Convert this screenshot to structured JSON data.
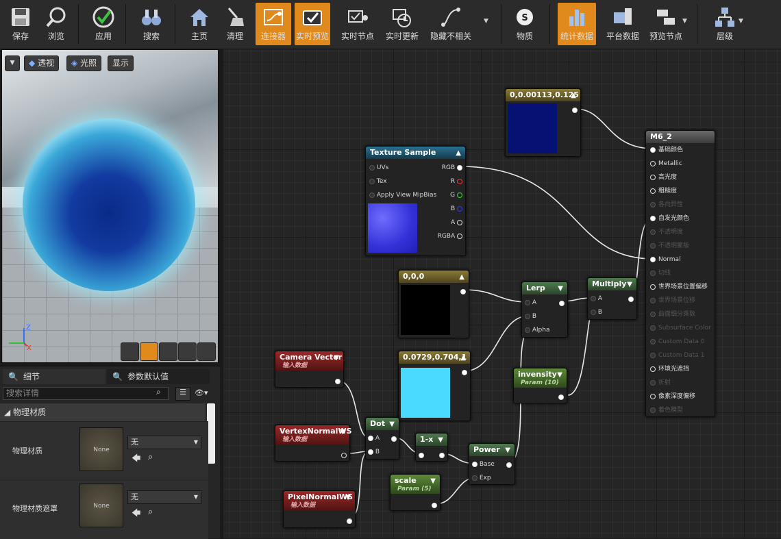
{
  "toolbar": {
    "buttons": [
      {
        "key": "save",
        "label": "保存",
        "icon": "save-icon",
        "active": false
      },
      {
        "key": "browse",
        "label": "浏览",
        "icon": "browse-icon",
        "active": false
      },
      {
        "key": "apply",
        "label": "应用",
        "icon": "apply-icon",
        "active": false
      },
      {
        "key": "search",
        "label": "搜索",
        "icon": "binoculars-icon",
        "active": false
      },
      {
        "key": "home",
        "label": "主页",
        "icon": "home-icon",
        "active": false
      },
      {
        "key": "clean",
        "label": "清理",
        "icon": "broom-icon",
        "active": false
      },
      {
        "key": "connectors",
        "label": "连接器",
        "icon": "connector-icon",
        "active": true
      },
      {
        "key": "live_preview",
        "label": "实时预览",
        "icon": "live-preview-icon",
        "active": true
      },
      {
        "key": "live_nodes",
        "label": "实时节点",
        "icon": "live-nodes-icon",
        "active": false
      },
      {
        "key": "live_update",
        "label": "实时更新",
        "icon": "live-update-icon",
        "active": false
      },
      {
        "key": "hide_unrelated",
        "label": "隐藏不相关",
        "icon": "hide-unrelated-icon",
        "active": false
      },
      {
        "key": "substance",
        "label": "物质",
        "icon": "substance-icon",
        "active": false
      },
      {
        "key": "stats",
        "label": "统计数据",
        "icon": "stats-icon",
        "active": true
      },
      {
        "key": "platform_stats",
        "label": "平台数据",
        "icon": "platform-stats-icon",
        "active": false
      },
      {
        "key": "preview_nodes",
        "label": "预览节点",
        "icon": "preview-nodes-icon",
        "active": false
      },
      {
        "key": "hierarchy",
        "label": "层级",
        "icon": "hierarchy-icon",
        "active": false
      }
    ]
  },
  "viewport": {
    "perspective": "透视",
    "lit": "光照",
    "show": "显示",
    "axis_z": "Z",
    "axis_x": "X"
  },
  "details": {
    "tab_details": "细节",
    "tab_params": "参数默认值",
    "search_placeholder": "搜索详情",
    "section": "物理材质",
    "rows": [
      {
        "label": "物理材质",
        "thumb": "None",
        "value": "无"
      },
      {
        "label": "物理材质遮罩",
        "thumb": "None",
        "value": "无"
      }
    ]
  },
  "graph": {
    "nodes": {
      "const_top": {
        "title": "0,0.00113,0.125",
        "swatch": "#061273"
      },
      "texture": {
        "title": "Texture Sample",
        "inputs": [
          "UVs",
          "Tex",
          "Apply View MipBias"
        ],
        "outputs": [
          "RGB",
          "R",
          "G",
          "B",
          "A",
          "RGBA"
        ]
      },
      "const_black": {
        "title": "0,0,0",
        "swatch": "#000000"
      },
      "const_cyan": {
        "title": "0.0729,0.704,1",
        "swatch": "#4ad9ff"
      },
      "lerp": {
        "title": "Lerp",
        "inputs": [
          "A",
          "B",
          "Alpha"
        ]
      },
      "multiply": {
        "title": "Multiply",
        "inputs": [
          "A",
          "B"
        ]
      },
      "invensity": {
        "title": "invensity",
        "sub": "Param (10)"
      },
      "camera": {
        "title": "Camera Vector",
        "sub": "输入数据"
      },
      "vertexnormal": {
        "title": "VertexNormalWS",
        "sub": "输入数据"
      },
      "pixelnormal": {
        "title": "PixelNormalWS",
        "sub": "输入数据"
      },
      "dot": {
        "title": "Dot",
        "inputs": [
          "A",
          "B"
        ]
      },
      "oneminus": {
        "title": "1-x"
      },
      "power": {
        "title": "Power",
        "inputs": [
          "Base",
          "Exp"
        ]
      },
      "scale": {
        "title": "scale",
        "sub": "Param (5)"
      },
      "result": {
        "title": "M6_2",
        "pins": [
          {
            "label": "基础颜色",
            "state": "filled"
          },
          {
            "label": "Metallic",
            "state": "empty"
          },
          {
            "label": "高光度",
            "state": "empty"
          },
          {
            "label": "粗糙度",
            "state": "empty"
          },
          {
            "label": "各向异性",
            "state": "disabled"
          },
          {
            "label": "自发光颜色",
            "state": "filled"
          },
          {
            "label": "不透明度",
            "state": "disabled"
          },
          {
            "label": "不透明蒙版",
            "state": "disabled"
          },
          {
            "label": "Normal",
            "state": "filled"
          },
          {
            "label": "切线",
            "state": "disabled"
          },
          {
            "label": "世界场景位置偏移",
            "state": "empty"
          },
          {
            "label": "世界场景位移",
            "state": "disabled"
          },
          {
            "label": "曲面细分乘数",
            "state": "disabled"
          },
          {
            "label": "Subsurface Color",
            "state": "disabled"
          },
          {
            "label": "Custom Data 0",
            "state": "disabled"
          },
          {
            "label": "Custom Data 1",
            "state": "disabled"
          },
          {
            "label": "环境光遮挡",
            "state": "empty"
          },
          {
            "label": "折射",
            "state": "disabled"
          },
          {
            "label": "像素深度偏移",
            "state": "empty"
          },
          {
            "label": "着色模型",
            "state": "disabled"
          }
        ]
      }
    }
  }
}
